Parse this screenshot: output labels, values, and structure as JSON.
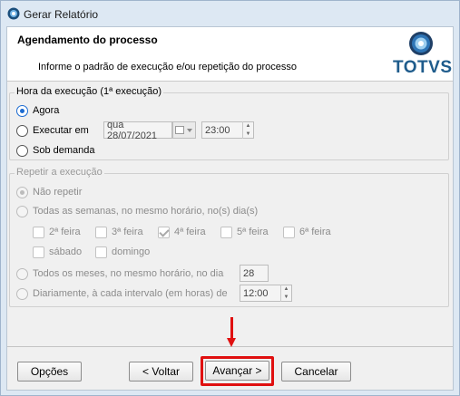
{
  "window": {
    "title": "Gerar Relatório"
  },
  "header": {
    "title": "Agendamento do processo",
    "subtitle": "Informe o padrão de execução e/ou repetição do processo",
    "logo_text": "TOTVS",
    "logo_color": "#1f5c8c"
  },
  "execution": {
    "legend": "Hora da execução (1ª execução)",
    "options": [
      {
        "label": "Agora",
        "selected": true
      },
      {
        "label": "Executar em",
        "selected": false
      },
      {
        "label": "Sob demanda",
        "selected": false
      }
    ],
    "date_value": "qua 28/07/2021",
    "time_value": "23:00"
  },
  "repeat": {
    "legend": "Repetir a execução",
    "options": [
      {
        "label": "Não repetir",
        "selected": true
      },
      {
        "label": "Todas as semanas, no mesmo horário, no(s) dia(s)",
        "selected": false
      },
      {
        "label": "Todos os meses, no mesmo horário, no dia",
        "selected": false
      },
      {
        "label": "Diariamente, à cada intervalo (em horas) de",
        "selected": false
      }
    ],
    "weekdays": [
      {
        "label": "2ª feira",
        "checked": false
      },
      {
        "label": "3ª feira",
        "checked": false
      },
      {
        "label": "4ª feira",
        "checked": true
      },
      {
        "label": "5ª feira",
        "checked": false
      },
      {
        "label": "6ª feira",
        "checked": false
      },
      {
        "label": "sábado",
        "checked": false
      },
      {
        "label": "domingo",
        "checked": false
      }
    ],
    "month_day_value": "28",
    "interval_value": "12:00"
  },
  "buttons": {
    "options": "Opções",
    "back": "< Voltar",
    "next": "Avançar >",
    "cancel": "Cancelar"
  },
  "annotation": {
    "color": "#e01010"
  }
}
